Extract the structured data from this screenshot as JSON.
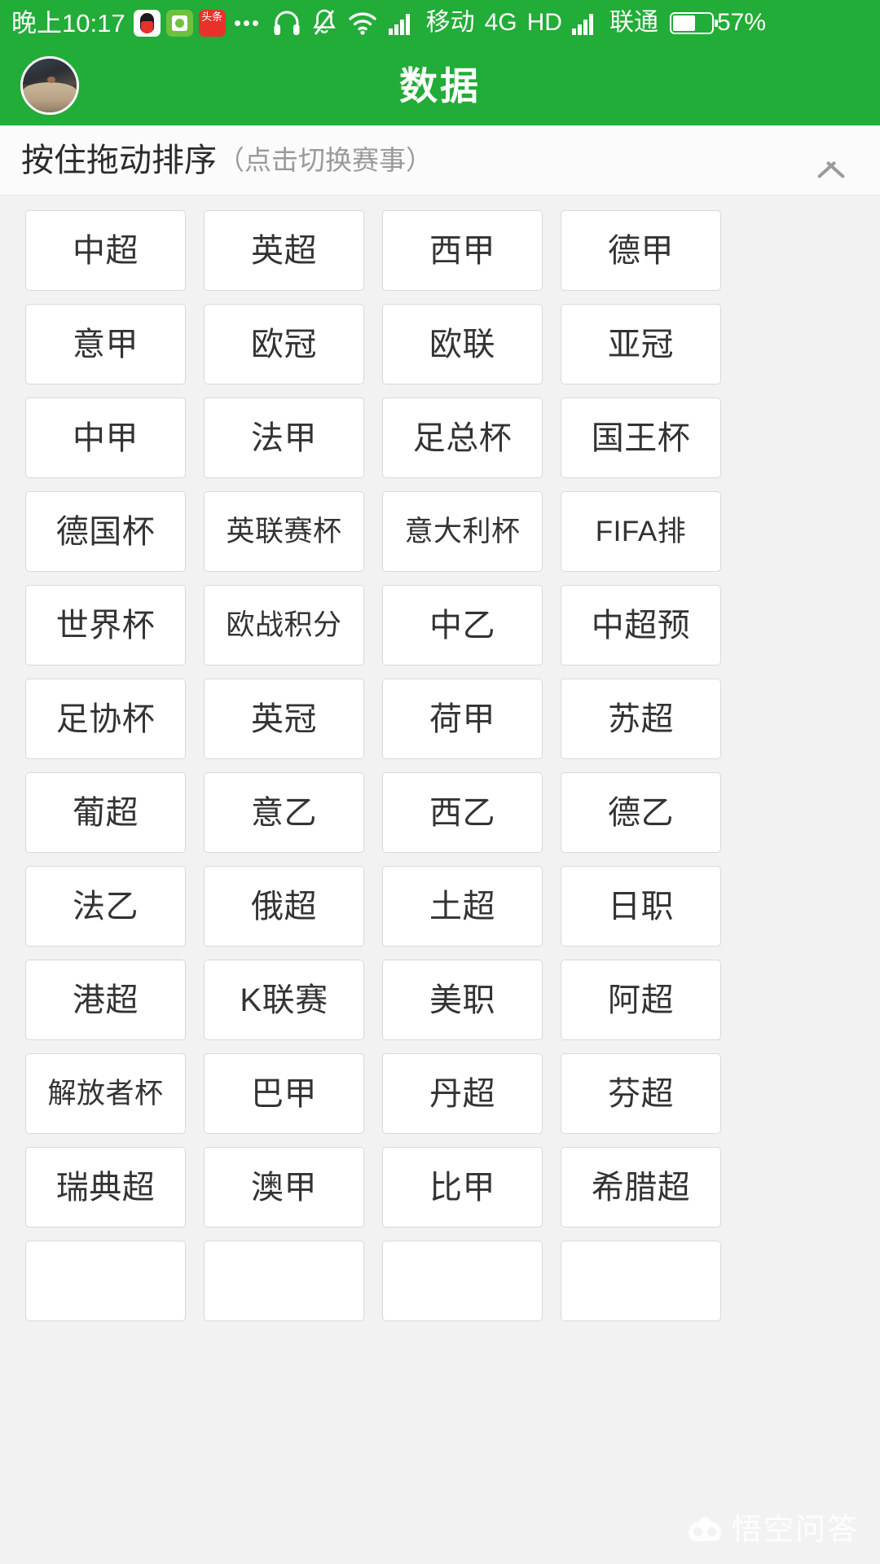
{
  "status_bar": {
    "time": "晚上10:17",
    "app_icons": [
      "qq-icon",
      "green-app-icon",
      "toutiao-icon"
    ],
    "more_icon": "more-dots-icon",
    "headphone_icon": "headphone-icon",
    "mute_icon": "bell-muted-icon",
    "wifi_icon": "wifi-icon",
    "signal_icon_1": "signal-bars-icon",
    "carrier_1": "移动",
    "network_type": "4G",
    "hd_label": "HD",
    "signal_icon_2": "signal-bars-icon",
    "carrier_2": "联通",
    "battery_icon": "battery-icon",
    "battery_level": "57%"
  },
  "title_bar": {
    "avatar": "user-avatar",
    "title": "数据"
  },
  "section_header": {
    "main_text": "按住拖动排序",
    "sub_text": "（点击切换赛事）",
    "collapse_icon": "chevron-up-icon"
  },
  "leagues": [
    "中超",
    "英超",
    "西甲",
    "德甲",
    "意甲",
    "欧冠",
    "欧联",
    "亚冠",
    "中甲",
    "法甲",
    "足总杯",
    "国王杯",
    "德国杯",
    "英联赛杯",
    "意大利杯",
    "FIFA排",
    "世界杯",
    "欧战积分",
    "中乙",
    "中超预",
    "足协杯",
    "英冠",
    "荷甲",
    "苏超",
    "葡超",
    "意乙",
    "西乙",
    "德乙",
    "法乙",
    "俄超",
    "土超",
    "日职",
    "港超",
    "K联赛",
    "美职",
    "阿超",
    "解放者杯",
    "巴甲",
    "丹超",
    "芬超",
    "瑞典超",
    "澳甲",
    "比甲",
    "希腊超",
    "",
    "",
    "",
    ""
  ],
  "watermark": {
    "text": "悟空问答",
    "logo": "wukong-owl-logo"
  },
  "colors": {
    "brand_green": "#22ac38",
    "page_background": "#f2f2f2",
    "card_background": "#ffffff",
    "card_border": "#d9d9d9",
    "primary_text": "#333333",
    "muted_text": "#9a9a9a"
  }
}
